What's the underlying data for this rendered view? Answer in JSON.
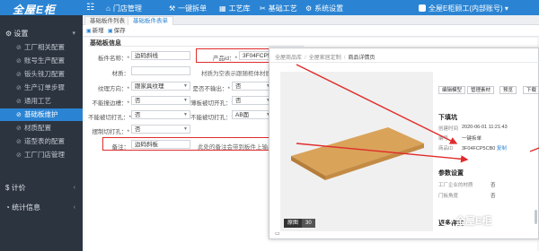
{
  "app": {
    "logo": "全屋E柜",
    "menu_icon": "grid-icon",
    "top_nav": [
      {
        "label": "门店管理",
        "icon": "store-icon"
      },
      {
        "label": "一键拆单",
        "icon": "split-icon"
      },
      {
        "label": "工艺库",
        "icon": "library-icon"
      },
      {
        "label": "基础工艺",
        "icon": "tool-icon"
      },
      {
        "label": "系统设置",
        "icon": "gear-icon"
      }
    ],
    "user": "全屋E柜顾工(内部账号)",
    "user_caret": "▾"
  },
  "sidebar": {
    "section_settings": "设置",
    "items": [
      {
        "label": "工厂相关配置",
        "icon": "link-icon"
      },
      {
        "label": "账号生产配置",
        "icon": "link-icon"
      },
      {
        "label": "钣头铣刀配置",
        "icon": "link-icon"
      },
      {
        "label": "生产订单步骤",
        "icon": "link-icon"
      },
      {
        "label": "通用工艺",
        "icon": "link-icon"
      },
      {
        "label": "基础板维护",
        "icon": "link-icon"
      },
      {
        "label": "材质配置",
        "icon": "link-icon"
      },
      {
        "label": "道型表的配置",
        "icon": "link-icon"
      },
      {
        "label": "工厂门店管理",
        "icon": "link-icon"
      }
    ],
    "section_pricing": "计价",
    "section_stats": "统计信息"
  },
  "tabs": [
    "基础板件列表",
    "基础板件表单"
  ],
  "toolbar": {
    "new_label": "新增",
    "save_label": "保存"
  },
  "form": {
    "title": "基础板信息",
    "part_name_label": "板件名称：*",
    "part_name_value": "边码斜线",
    "product_id_label": "产品id：*",
    "product_id_value": "3F04FCP5CB0",
    "material_label": "材质：",
    "material_hint": "材质为空表示跟随柜体材质",
    "texture_label": "纹理方向：*",
    "texture_value": "跟家具纹理",
    "hide_output_label": "是否不输出：*",
    "hide_output_value": "否",
    "no_edge_label": "不能撞边槽：*",
    "no_edge_value": "否",
    "thin_part_label": "薄板被切开孔：*",
    "thin_part_value": "否",
    "no_cut_label": "不能被切打孔：*",
    "no_cut_value": "否",
    "no_cut2_label": "不能被切打孔：*",
    "no_cut2_value": "AB面",
    "profile_label": "摆制切打孔：*",
    "profile_value": "否",
    "remark_label": "备注：",
    "remark_value": "边码斜板",
    "remark_hint": "此处的备注会带到板件上输出到料单"
  },
  "preview": {
    "breadcrumb": [
      "全屋商品库",
      "全屋家居定制",
      "商品详情页"
    ],
    "buttons": [
      "编辑模型",
      "管理素材",
      "预览",
      "下载"
    ],
    "side_title": "下填坑",
    "rows": [
      {
        "label": "创建时间",
        "value": "2020-06-01 11:21:43"
      },
      {
        "label": "编号",
        "value": "一键拆单"
      },
      {
        "label": "商品ID",
        "value": "3F04FCP5CB0",
        "link": "复制"
      }
    ],
    "params_title": "参数设置",
    "params": [
      {
        "label": "工厂企业的材质",
        "value": "否"
      },
      {
        "label": "门板角度",
        "value": "否"
      }
    ],
    "more_title": "更多样式",
    "badge_left": "原图",
    "badge_right": "30"
  },
  "watermark": "全屋E柜",
  "colors": {
    "brand_blue": "#2b84d3",
    "sidebar_bg": "#2c3440",
    "highlight_red": "#e02b2b",
    "wood": "#d9a35a"
  }
}
